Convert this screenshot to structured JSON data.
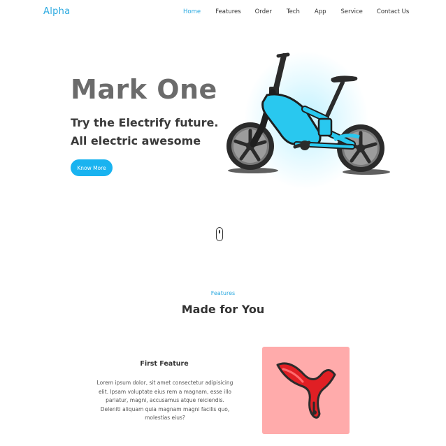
{
  "nav": {
    "brand": "Alpha",
    "items": [
      {
        "label": "Home",
        "active": true
      },
      {
        "label": "Features",
        "active": false
      },
      {
        "label": "Order",
        "active": false
      },
      {
        "label": "Tech",
        "active": false
      },
      {
        "label": "App",
        "active": false
      },
      {
        "label": "Service",
        "active": false
      },
      {
        "label": "Contact Us",
        "active": false
      }
    ]
  },
  "hero": {
    "title": "Mark One",
    "subtitle_line1": "Try the Electrify future.",
    "subtitle_line2": "All electric awesome",
    "cta_label": "Know More",
    "image_icon": "electric-bike"
  },
  "scroll_indicator": {
    "icon": "mouse-scroll-icon"
  },
  "features": {
    "kicker": "Features",
    "title": "Made for You",
    "first": {
      "title": "First Feature",
      "text": "Lorem ipsum dolor, sit amet consectetur adipisicing elit. Ipsam voluptate eius rem a magnam, esse illo pariatur, magni, accusamus atque reiciendis. Deleniti aliquam quia magnam magni facilis quo, molestias eius?",
      "image_icon": "bike-frame"
    }
  },
  "colors": {
    "accent": "#2aa9e0",
    "button": "#19b3f0",
    "bike_frame": "#29c8ef",
    "card_bg": "#ffabab",
    "part_red": "#e01f24"
  }
}
